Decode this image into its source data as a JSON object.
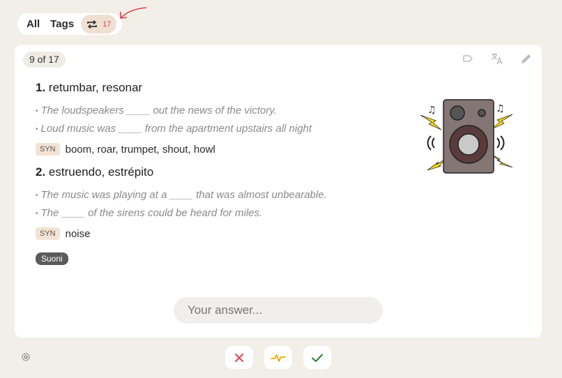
{
  "tabs": {
    "all_label": "All",
    "tags_label": "Tags",
    "repeat_icon": "repeat-icon",
    "repeat_count": "17"
  },
  "card": {
    "progress": "9 of 17",
    "actions": [
      "label-icon",
      "translate-icon",
      "edit-icon"
    ],
    "entries": [
      {
        "number": "1.",
        "word": "retumbar, resonar",
        "examples": [
          "The loudspeakers ____ out the news of the victory.",
          "Loud music was ____ from the apartment upstairs all night"
        ],
        "syn_label": "SYN",
        "synonyms": "boom, roar, trumpet, shout, howl"
      },
      {
        "number": "2.",
        "word": "estruendo, estrépito",
        "examples": [
          "The music was playing at a ____ that was almost unbearable.",
          "The ____ of the sirens could be heard for miles."
        ],
        "syn_label": "SYN",
        "synonyms": "noise"
      }
    ],
    "tag": "Suoni",
    "illustration_icon": "loudspeaker-icon"
  },
  "answer": {
    "placeholder": "Your answer..."
  },
  "footer": {
    "settings_icon": "gear-icon",
    "grades": [
      "wrong-icon",
      "hard-icon",
      "correct-icon"
    ]
  },
  "colors": {
    "background": "#f2efe8",
    "accent_red": "#d8454a",
    "hard_orange": "#f0a500",
    "correct_green": "#2e7d32"
  }
}
